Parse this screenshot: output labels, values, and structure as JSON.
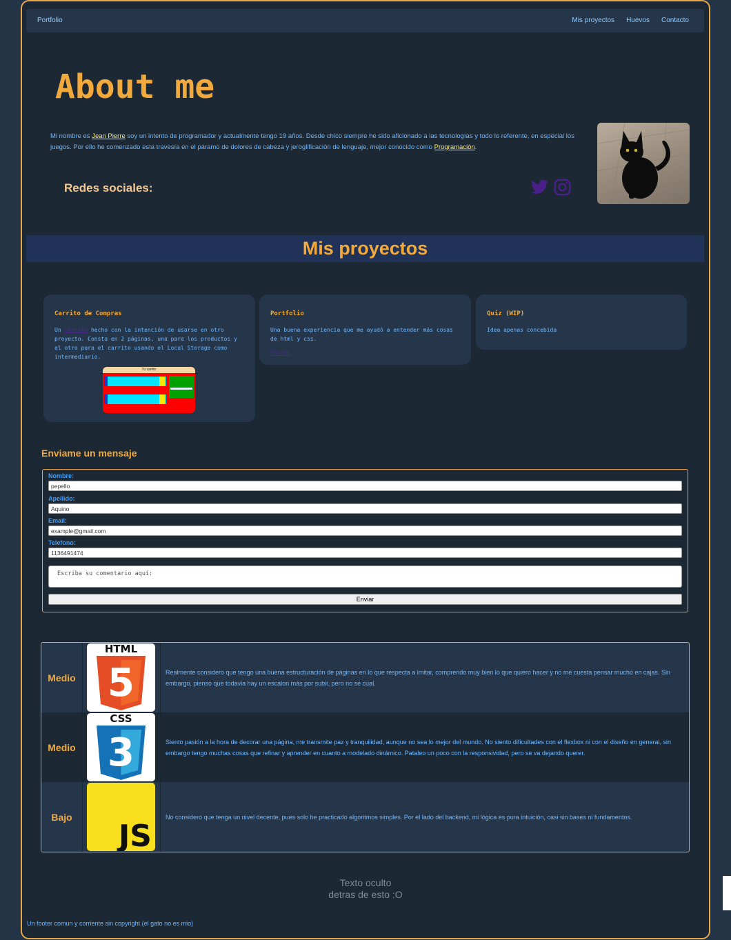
{
  "navbar": {
    "brand": "Portfolio",
    "links": [
      "Mis proyectos",
      "Huevos",
      "Contacto"
    ]
  },
  "about": {
    "title": "About me",
    "text_part1": "Mi nombre es ",
    "name_link": "Jean Pierre",
    "text_part2": " soy un intento de programador y actualmente tengo 19 años. Desde chico siempre he sido aficionado a las tecnologías y todo lo referente, en especial los juegos. Por ello he comenzado esta travesía en el páramo de dolores de cabeza y jeroglificación de lenguaje, mejor conocido como ",
    "prog_link": "Programación",
    "text_part3": ".",
    "socials_title": "Redes sociales:",
    "social_icons": [
      "twitter-icon",
      "instagram-icon"
    ]
  },
  "projects": {
    "title": "Mis proyectos",
    "cards": [
      {
        "title": "Carrito de Compras",
        "pre": "Un ",
        "link": "carrito",
        "post": " hecho con la intención de usarse en otro proyecto. Consta en 2 páginas, una para los productos y el otro para el carrito usando el Local Storage como intermediario.",
        "thumb_title": "Tu carrito"
      },
      {
        "title": "Portfolio",
        "text": "Una buena experiencia que me ayudó a entender más cosas de html y css.",
        "link": "Enlace"
      },
      {
        "title": "Quiz (WIP)",
        "text": "Idea apenas concebida"
      }
    ]
  },
  "contact": {
    "title": "Enviame un mensaje",
    "fields": [
      {
        "label": "Nombre:",
        "value": "pepello"
      },
      {
        "label": "Apellido:",
        "value": "Aquino"
      },
      {
        "label": "Email:",
        "value": "example@gmail.com"
      },
      {
        "label": "Telefono:",
        "value": "1136491474"
      }
    ],
    "comment_placeholder": "Escriba su comentario aquí:",
    "submit_label": "Enviar"
  },
  "skills": [
    {
      "level": "Medio",
      "logo": "html5-logo",
      "logo_text": "HTML",
      "badge": "5",
      "color": "#e44d26",
      "row_bg": "#26364a",
      "desc": "Realmente considero que tengo una buena estructuración de páginas en lo que respecta a imitar, comprendo muy bien lo que quiero hacer y no me cuesta pensar mucho en cajas. Sin embargo, pienso que todavia hay un escalon más por subir, pero no se cual."
    },
    {
      "level": "Medio",
      "logo": "css3-logo",
      "logo_text": "CSS",
      "badge": "3",
      "color": "#2a7cd3",
      "row_bg": "#1c2834",
      "desc": "Siento pasión a la hora de decorar una página, me transmite paz y tranquilidad, aunque no sea lo mejor del mundo. No siento dificultades con el flexbox ni con el diseño en general, sin embargo tengo muchas cosas que refinar y aprender en cuanto a modelado dinámico. Pataleo un poco con la responsividad, pero se va dejando querer."
    },
    {
      "level": "Bajo",
      "logo": "js-logo",
      "logo_text": "JS",
      "color": "#f7df1e",
      "row_bg": "#26364a",
      "desc": "No considero que tenga un nivel decente, pues solo he practicado algoritmos simples. Por el lado del backend, mi lógica es pura intuición, casi sin bases ni fundamentos."
    }
  ],
  "hidden_text": [
    "Texto oculto",
    "detras de esto :O"
  ],
  "footer": "Un footer comun y corriente sin copyright (el gato no es mio)"
}
